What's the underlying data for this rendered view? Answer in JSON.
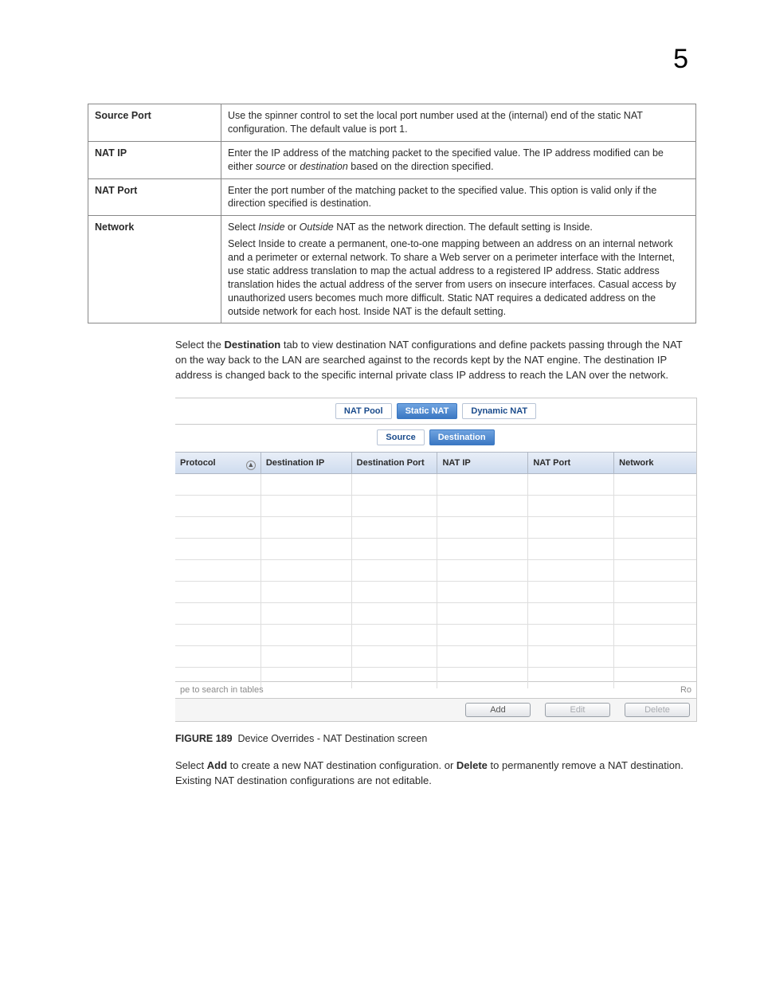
{
  "page_number": "5",
  "param_table": [
    {
      "name": "Source Port",
      "desc": [
        "Use the spinner control to set the local port number used at the (internal) end of the static NAT configuration. The default value is port 1."
      ]
    },
    {
      "name": "NAT IP",
      "desc": [
        "Enter the IP address of the matching packet to the specified value. The IP address modified can be either <i>source</i> or <i>destination</i> based on the direction specified."
      ]
    },
    {
      "name": "NAT Port",
      "desc": [
        "Enter the port number of the matching packet to the specified value. This option is valid only if the direction specified is destination."
      ]
    },
    {
      "name": "Network",
      "desc": [
        "Select <i>Inside</i> or <i>Outside</i> NAT as the network direction. The default setting is Inside.",
        "Select Inside to create a permanent, one-to-one mapping between an address on an internal network and a perimeter or external network. To share a Web server on a perimeter interface with the Internet, use static address translation to map the actual address to a registered IP address. Static address translation hides the actual address of the server from users on insecure interfaces. Casual access by unauthorized users becomes much more difficult. Static NAT requires a dedicated address on the outside network for each host. Inside NAT is the default setting."
      ]
    }
  ],
  "para_destination": {
    "pre": "Select the ",
    "bold": "Destination",
    "post": " tab to view destination NAT configurations and define packets passing through the NAT on the way back to the LAN are searched against to the records kept by the NAT engine. The destination IP address is changed back to the specific internal private class IP address to reach the LAN over the network."
  },
  "shot": {
    "tabs": {
      "nat_pool": "NAT Pool",
      "static_nat": "Static NAT",
      "dynamic_nat": "Dynamic NAT"
    },
    "subtabs": {
      "source": "Source",
      "destination": "Destination"
    },
    "columns": {
      "protocol": "Protocol",
      "destip": "Destination IP",
      "destport": "Destination Port",
      "natip": "NAT IP",
      "natport": "NAT Port",
      "network": "Network"
    },
    "search_placeholder": "pe to search in tables",
    "search_right": "Ro",
    "buttons": {
      "add": "Add",
      "edit": "Edit",
      "delete": "Delete"
    }
  },
  "figure_caption": {
    "label": "FIGURE 189",
    "text": "Device Overrides - NAT Destination screen"
  },
  "para_add": {
    "t1": "Select ",
    "b1": "Add",
    "t2": " to create a new NAT destination configuration. or ",
    "b2": "Delete",
    "t3": " to permanently remove a NAT destination. Existing NAT destination configurations are not editable."
  }
}
